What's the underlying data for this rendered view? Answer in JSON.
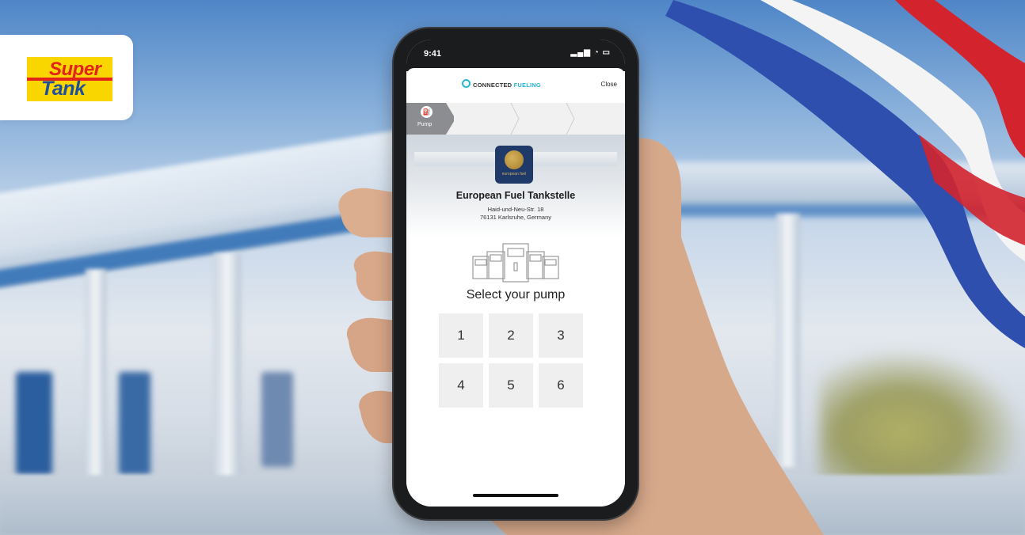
{
  "logo": {
    "line1": "Super",
    "line2": "Tank"
  },
  "status_bar": {
    "time": "9:41",
    "icons": "signal-icon wifi-icon battery-icon"
  },
  "nav": {
    "brand_prefix": "CONNECTED",
    "brand_accent": "FUELING",
    "close_label": "Close"
  },
  "steps": [
    {
      "label": "Pump",
      "active": true,
      "icon": "fuel-pump-icon"
    },
    {
      "label": "",
      "active": false
    },
    {
      "label": "",
      "active": false
    }
  ],
  "station": {
    "logo_text": "european fuel",
    "name": "European Fuel Tankstelle",
    "address_line1": "Haid-und-Neu-Str. 18",
    "address_line2": "76131 Karlsruhe, Germany"
  },
  "prompt": "Select your pump",
  "pumps": [
    "1",
    "2",
    "3",
    "4",
    "5",
    "6"
  ],
  "colors": {
    "accent": "#27b6d8",
    "step_active": "#8b8d90",
    "logo_yellow": "#f9d600",
    "logo_red": "#e2231a",
    "logo_blue": "#1d4f9c"
  }
}
